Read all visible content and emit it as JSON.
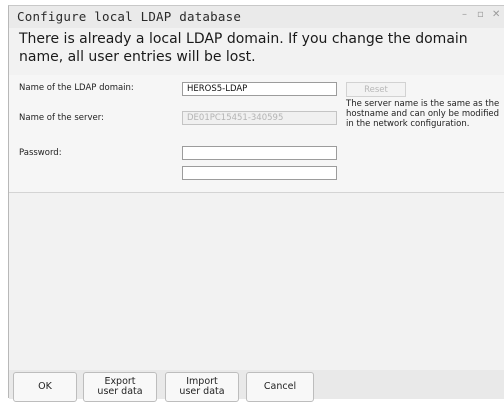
{
  "window": {
    "title": "Configure local LDAP database",
    "minimize_glyph": "–",
    "maximize_glyph": "▫",
    "close_glyph": "✕"
  },
  "notice": "There is already a local LDAP domain. If you change the domain name, all user entries will be lost.",
  "form": {
    "domain_label": "Name of the LDAP domain:",
    "domain_value": "HEROS5-LDAP",
    "server_label": "Name of the server:",
    "server_value": "DE01PC15451-340595",
    "password_label": "Password:",
    "password_value": "",
    "password_confirm_value": "",
    "reset_label": "Reset",
    "server_note": "The server name is the same as the hostname and can only be modified in the network configuration."
  },
  "buttons": {
    "ok": "OK",
    "export_line1": "Export",
    "export_line2": "user data",
    "import_line1": "Import",
    "import_line2": "user data",
    "cancel": "Cancel"
  },
  "colors": {
    "dialog_background": "#f2f2f2",
    "disabled_text": "#b4b4b4",
    "field_border": "#9c9c9c"
  }
}
